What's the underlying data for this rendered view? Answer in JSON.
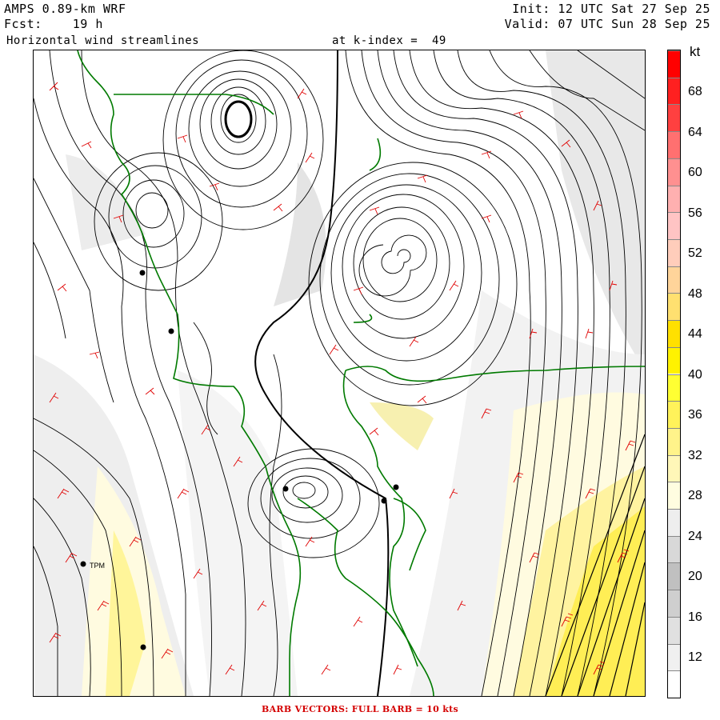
{
  "header": {
    "model": "AMPS 0.89-km WRF",
    "forecast": "Fcst:    19 h",
    "title": "Horizontal wind streamlines",
    "level": "at k-index =  49",
    "init": "Init: 12 UTC Sat 27 Sep 25",
    "valid": "Valid: 07 UTC Sun 28 Sep 25"
  },
  "colorbar": {
    "unit": "kt",
    "labels": [
      "68",
      "64",
      "60",
      "56",
      "52",
      "48",
      "44",
      "40",
      "36",
      "32",
      "28",
      "24",
      "20",
      "16",
      "12"
    ],
    "colors": [
      "#ffffff",
      "#f0f0f0",
      "#e0e0e0",
      "#cfcfcf",
      "#c0c0c0",
      "#d8d8d8",
      "#eeeeee",
      "#fffde0",
      "#fff7b8",
      "#fff38a",
      "#fff25a",
      "#ffff33",
      "#fff200",
      "#ffe000",
      "#ffe070",
      "#ffd49a",
      "#ffcdbb",
      "#ffc4c4",
      "#ffb0b0",
      "#ff9090",
      "#ff7070",
      "#ff4040",
      "#ff2020",
      "#ff0000"
    ]
  },
  "stations": [
    {
      "name": "TPM",
      "label": "TPM"
    },
    {
      "name": "stn-a",
      "label": ""
    },
    {
      "name": "stn-b",
      "label": ""
    },
    {
      "name": "stn-c",
      "label": ""
    },
    {
      "name": "stn-d",
      "label": ""
    },
    {
      "name": "stn-e",
      "label": ""
    },
    {
      "name": "stn-f",
      "label": ""
    }
  ],
  "footer": "BARB VECTORS:  FULL BARB = 10 kts"
}
